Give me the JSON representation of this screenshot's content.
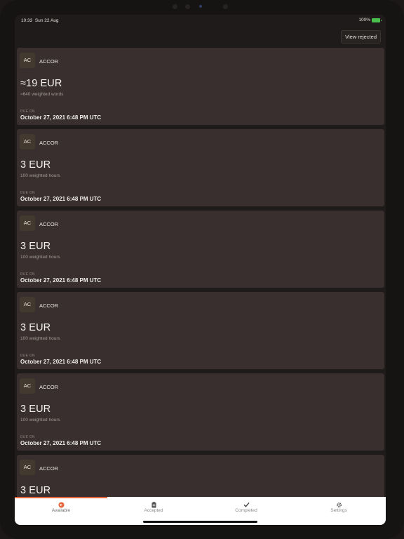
{
  "status_bar": {
    "time": "10:33",
    "date": "Sun 22 Aug",
    "battery_text": "100%",
    "battery_icon": "battery-full-icon",
    "battery_color": "#47c14c"
  },
  "header": {
    "view_rejected_label": "View rejected"
  },
  "cards": [
    {
      "avatar": "AC",
      "client": "ACCOR",
      "amount": "≈19 EUR",
      "volume": "≈640 weighted words",
      "due_label": "DUE ON",
      "due_date": "October 27, 2021 6:48 PM UTC"
    },
    {
      "avatar": "AC",
      "client": "ACCOR",
      "amount": "3 EUR",
      "volume": "100 weighted hours",
      "due_label": "DUE ON",
      "due_date": "October 27, 2021 6:48 PM UTC"
    },
    {
      "avatar": "AC",
      "client": "ACCOR",
      "amount": "3 EUR",
      "volume": "100 weighted hours",
      "due_label": "DUE ON",
      "due_date": "October 27, 2021 6:48 PM UTC"
    },
    {
      "avatar": "AC",
      "client": "ACCOR",
      "amount": "3 EUR",
      "volume": "100 weighted hours",
      "due_label": "DUE ON",
      "due_date": "October 27, 2021 6:48 PM UTC"
    },
    {
      "avatar": "AC",
      "client": "ACCOR",
      "amount": "3 EUR",
      "volume": "100 weighted hours",
      "due_label": "DUE ON",
      "due_date": "October 27, 2021 6:48 PM UTC"
    },
    {
      "avatar": "AC",
      "client": "ACCOR",
      "amount": "3 EUR",
      "volume": "",
      "due_label": "",
      "due_date": ""
    }
  ],
  "tabs": [
    {
      "label": "Available",
      "icon": "available-icon",
      "active": true
    },
    {
      "label": "Accepted",
      "icon": "clipboard-icon",
      "active": false
    },
    {
      "label": "Completed",
      "icon": "checkmark-icon",
      "active": false
    },
    {
      "label": "Settings",
      "icon": "gear-icon",
      "active": false
    }
  ],
  "colors": {
    "accent": "#e8663c",
    "card_background": "#382f2e",
    "screen_background": "#1f1b1a",
    "tab_bar_background": "#ffffff"
  }
}
